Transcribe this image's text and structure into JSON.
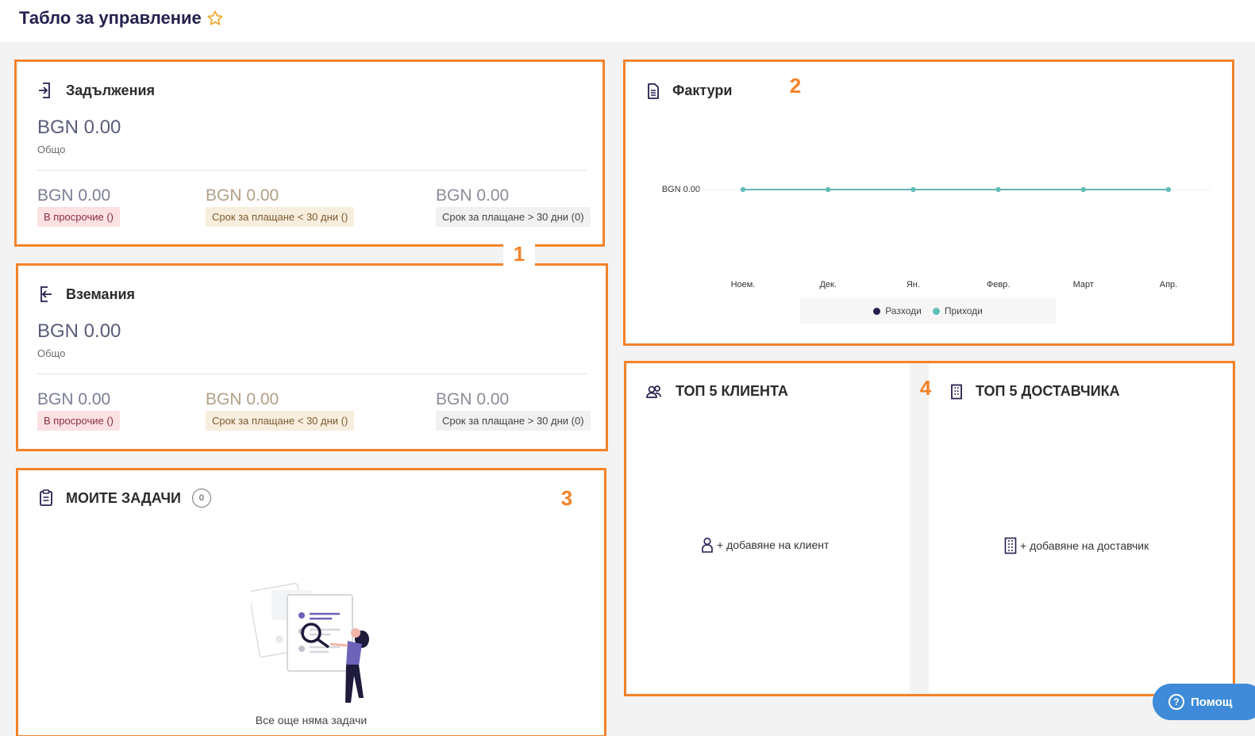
{
  "header": {
    "title": "Табло за управление",
    "star_icon": "star-outline-icon",
    "accent": "#f5a623"
  },
  "markers": {
    "m1": "1",
    "m2": "2",
    "m3": "3",
    "m4": "4"
  },
  "payables": {
    "title": "Задължения",
    "total": "BGN 0.00",
    "total_label": "Общо",
    "overdue_amount": "BGN 0.00",
    "overdue_label": "В просрочие ()",
    "due_soon_amount": "BGN 0.00",
    "due_soon_label": "Срок за плащане < 30 дни ()",
    "due_later_amount": "BGN 0.00",
    "due_later_label": "Срок за плащане > 30 дни (0)"
  },
  "receivables": {
    "title": "Вземания",
    "total": "BGN 0.00",
    "total_label": "Общо",
    "overdue_amount": "BGN 0.00",
    "overdue_label": "В просрочие ()",
    "due_soon_amount": "BGN 0.00",
    "due_soon_label": "Срок за плащане < 30 дни ()",
    "due_later_amount": "BGN 0.00",
    "due_later_label": "Срок за плащане > 30 дни (0)"
  },
  "tasks": {
    "title": "МОИТЕ ЗАДАЧИ",
    "count": "0",
    "empty_text": "Все още няма задачи"
  },
  "invoices": {
    "title": "Фактури"
  },
  "chart_data": {
    "type": "line",
    "title": "Фактури",
    "categories": [
      "Ноем.",
      "Дек.",
      "Ян.",
      "Февр.",
      "Март",
      "Апр."
    ],
    "y_tick_label": "BGN 0.00",
    "series": [
      {
        "name": "Разходи",
        "values": [
          0,
          0,
          0,
          0,
          0,
          0
        ],
        "color": "#25214f"
      },
      {
        "name": "Приходи",
        "values": [
          0,
          0,
          0,
          0,
          0,
          0
        ],
        "color": "#5cc0b8"
      }
    ],
    "legend_position": "bottom"
  },
  "top_clients": {
    "title": "ТОП 5 КЛИЕНТА",
    "add_label": "+ добавяне на клиент"
  },
  "top_suppliers": {
    "title": "ТОП 5 ДОСТАВЧИКА",
    "add_label": "+ добавяне на доставчик"
  },
  "help": {
    "label": "Помощ"
  }
}
